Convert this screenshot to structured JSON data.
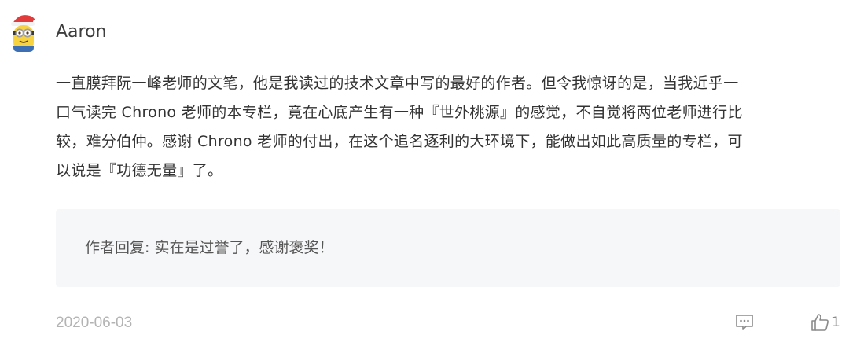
{
  "comment": {
    "username": "Aaron",
    "avatar_icon": "minion-santa-hat-icon",
    "content": "一直膜拜阮一峰老师的文笔，他是我读过的技术文章中写的最好的作者。但令我惊讶的是，当我近乎一\n口气读完 Chrono 老师的本专栏，竟在心底产生有一种『世外桃源』的感觉，不自觉将两位老师进行比\n较，难分伯仲。感谢 Chrono 老师的付出，在这个追名逐利的大环境下，能做出如此高质量的专栏，可\n以说是『功德无量』了。",
    "reply": "作者回复: 实在是过誉了，感谢褒奖！",
    "date": "2020-06-03",
    "like_count": "1"
  },
  "icons": {
    "comment": "comment-bubble-icon",
    "like": "thumbs-up-icon"
  },
  "colors": {
    "text": "#333333",
    "muted": "#b3b3b3",
    "reply_bg": "#f6f7f9"
  }
}
